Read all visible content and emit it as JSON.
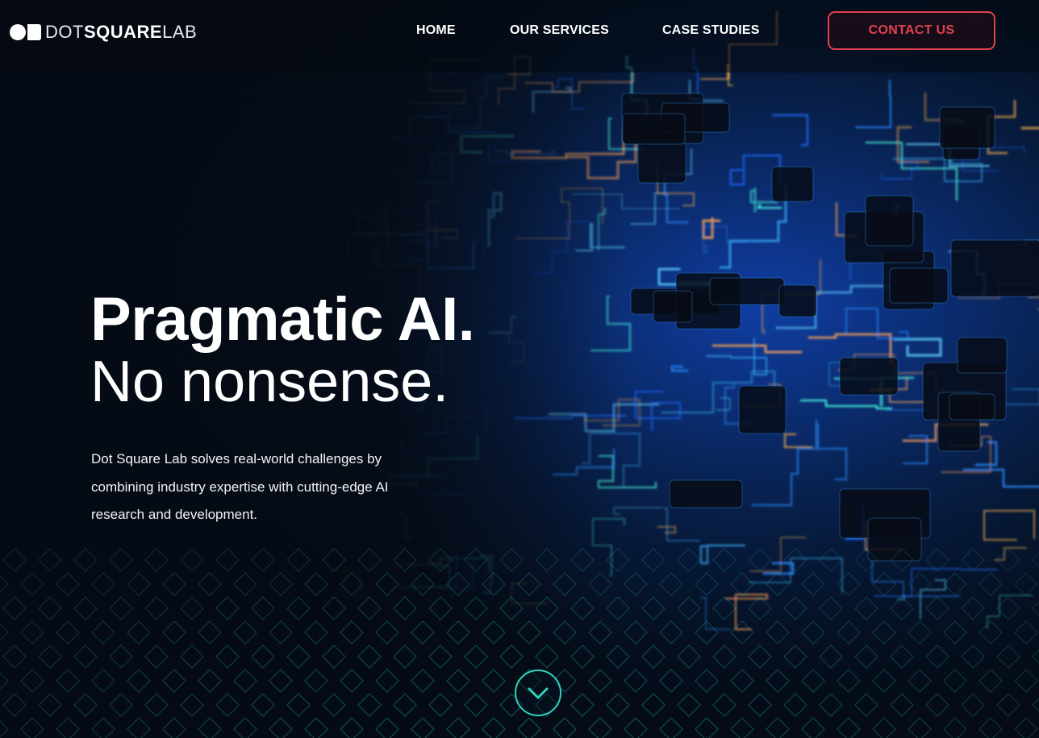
{
  "brand": {
    "logo_light": "DOT",
    "logo_bold": "SQUARE",
    "logo_suffix": "LAB"
  },
  "nav": {
    "items": [
      {
        "label": "HOME"
      },
      {
        "label": "OUR SERVICES"
      },
      {
        "label": "CASE STUDIES"
      }
    ],
    "contact_label": "CONTACT US"
  },
  "hero": {
    "title_line1": "Pragmatic AI.",
    "title_line2": "No nonsense.",
    "description": "Dot Square Lab solves real-world challenges by combining industry expertise with cutting-edge AI research and development.",
    "scroll_icon": "chevron-down-check-icon"
  },
  "colors": {
    "accent": "#e0414f",
    "teal": "#2ed3c0",
    "background": "#050b14",
    "circuit_blue": "#1e6bff"
  }
}
